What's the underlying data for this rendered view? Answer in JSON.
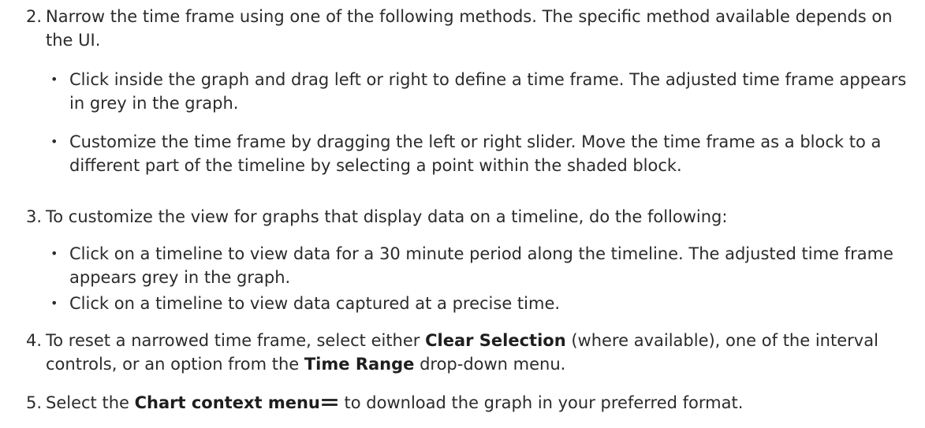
{
  "steps": [
    {
      "number": "2.",
      "text": "Narrow the time frame using one of the following methods. The specific method available depends on the UI.",
      "bullets": [
        "Click inside the graph and drag left or right to define a time frame. The adjusted time frame appears in grey in the graph.",
        "Customize the time frame by dragging the left or right slider. Move the time frame as a block to a different part of the timeline by selecting a point within the shaded block."
      ]
    },
    {
      "number": "3.",
      "text": "To customize the view for graphs that display data on a timeline, do the following:",
      "bullets": [
        "Click on a timeline to view data for a 30 minute period along the timeline. The adjusted time frame appears grey in the graph.",
        "Click on a timeline to view data captured at a precise time."
      ]
    },
    {
      "number": "4.",
      "parts": {
        "a": "To reset a narrowed time frame, select either ",
        "b": "Clear Selection",
        "c": " (where available), one of the interval controls, or an option from the ",
        "d": "Time Range",
        "e": " drop-down menu."
      }
    },
    {
      "number": "5.",
      "parts": {
        "a": "Select the ",
        "b": "Chart context menu",
        "icon": "hamburger-menu-icon",
        "c": " to download the graph in your preferred format."
      }
    }
  ],
  "bullet_symbol": "•"
}
